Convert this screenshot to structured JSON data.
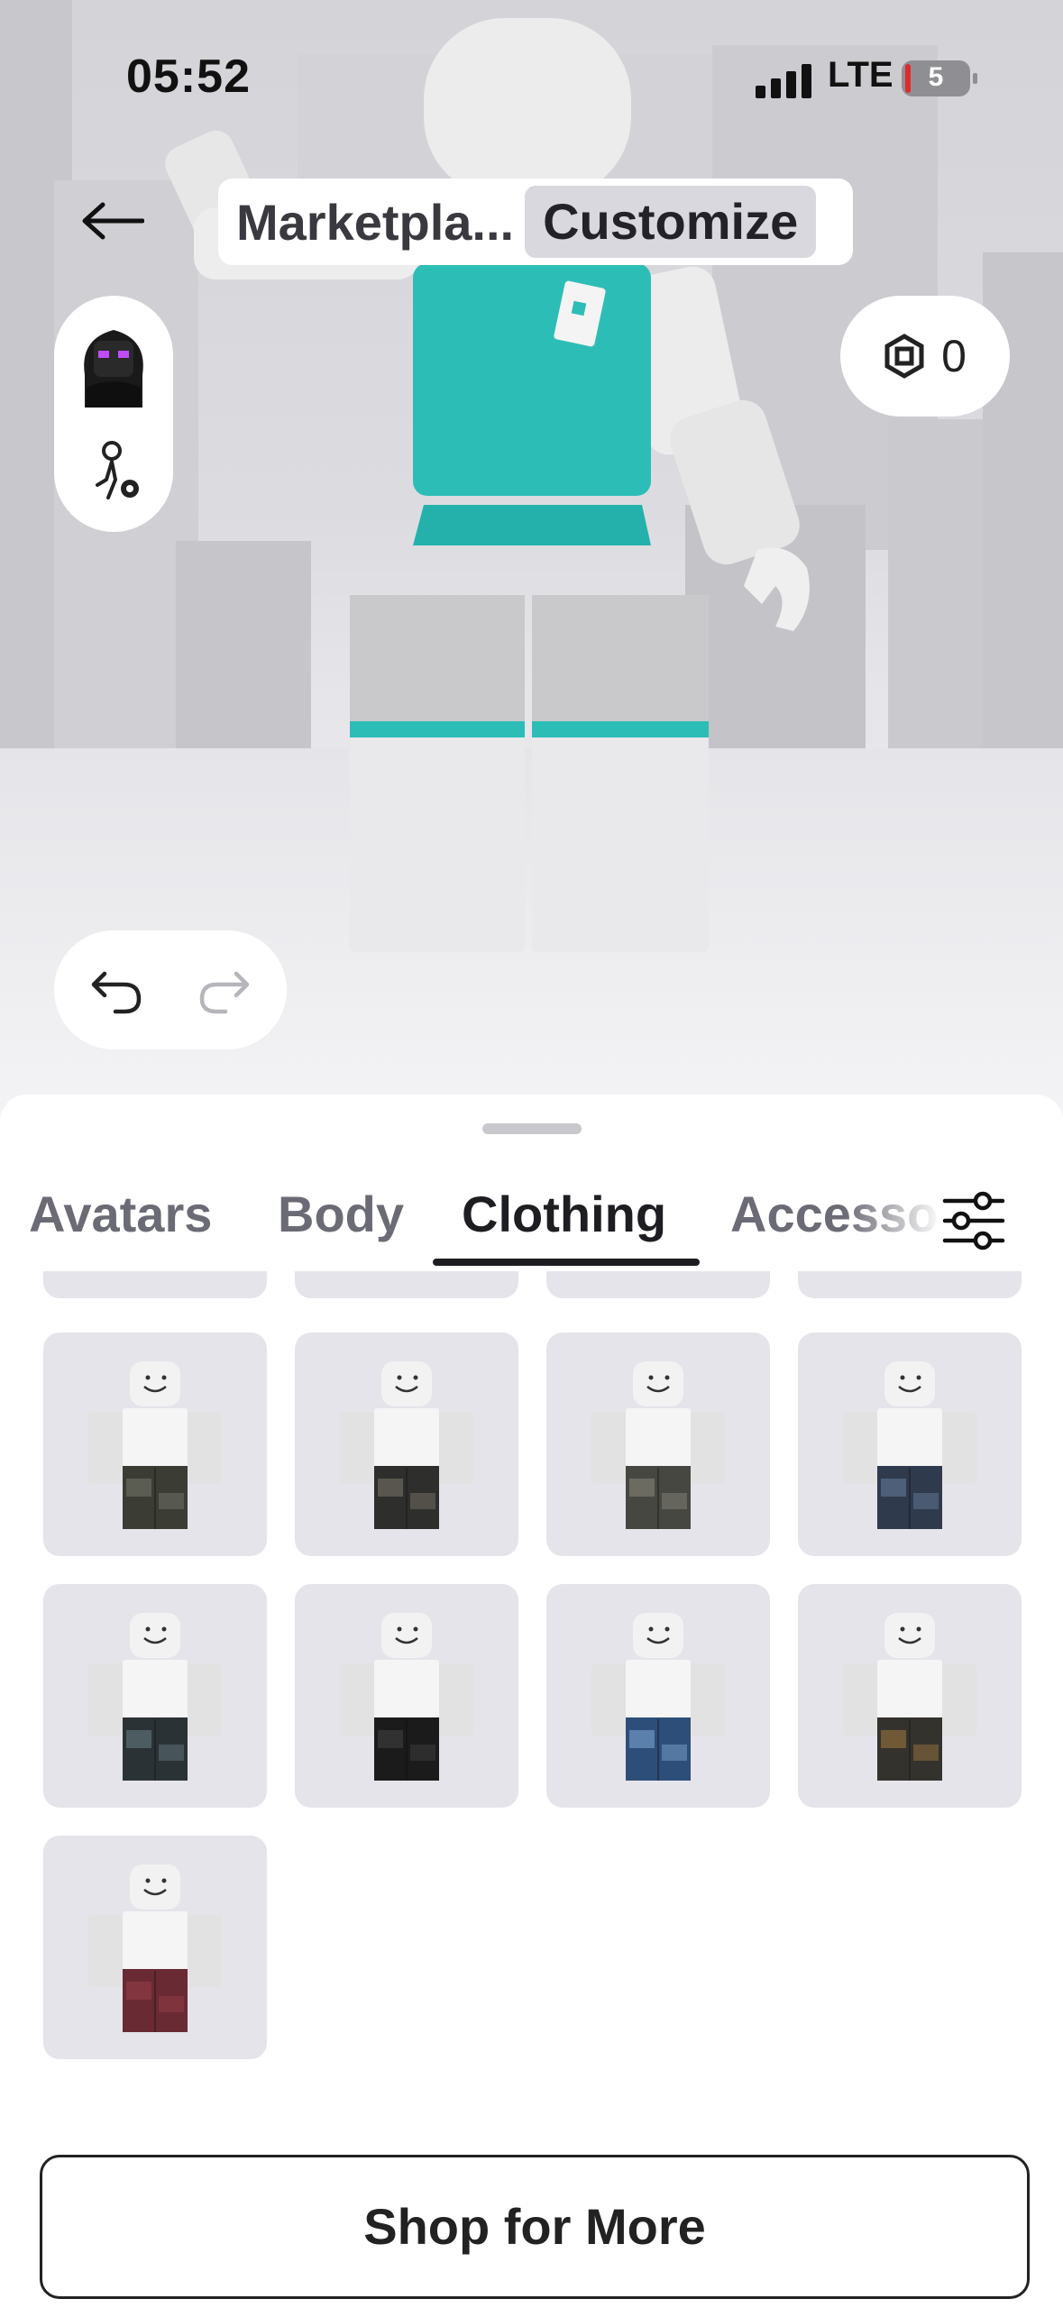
{
  "status_bar": {
    "time": "05:52",
    "network": "LTE",
    "battery": "5"
  },
  "header": {
    "segments": [
      "Marketpla...",
      "Customize"
    ],
    "active_segment": "Customize"
  },
  "currency": {
    "icon": "robux-icon",
    "amount": "0"
  },
  "category_tabs": {
    "items": [
      "Avatars",
      "Body",
      "Clothing",
      "Accesso"
    ],
    "active": "Clothing"
  },
  "items_grid": {
    "rows": [
      [
        {
          "pants_color": "#3b3d35",
          "accent": "#6a6a60"
        },
        {
          "pants_color": "#2e2f2c",
          "accent": "#6b675c"
        },
        {
          "pants_color": "#474741",
          "accent": "#7c7a70"
        },
        {
          "pants_color": "#2f3a4d",
          "accent": "#5b6f8c"
        }
      ],
      [
        {
          "pants_color": "#2a3236",
          "accent": "#5b6d73"
        },
        {
          "pants_color": "#1b1b1b",
          "accent": "#3a3a3a"
        },
        {
          "pants_color": "#2d4e78",
          "accent": "#6f95c0"
        },
        {
          "pants_color": "#34322d",
          "accent": "#8a6a3c"
        }
      ],
      [
        {
          "pants_color": "#6a2a33",
          "accent": "#8e3a45"
        }
      ]
    ]
  },
  "bottom_button": {
    "label": "Shop for More"
  },
  "colors": {
    "accent_teal": "#2dbdb7",
    "tile_bg": "#e4e4ea",
    "text_dark": "#1d1d22"
  }
}
